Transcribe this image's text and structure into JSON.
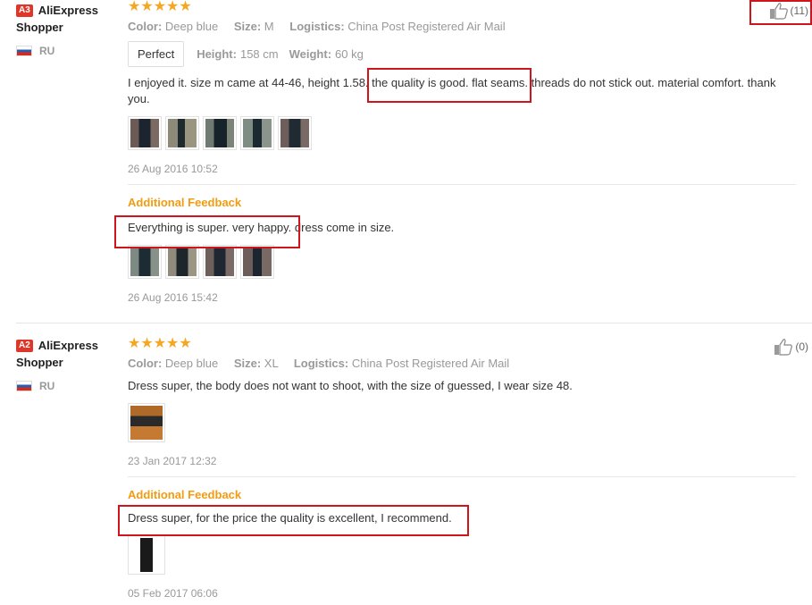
{
  "reviews": [
    {
      "level": "A3",
      "user_name": "AliExpress Shopper",
      "country": "RU",
      "stars": "★★★★★",
      "attrs": [
        {
          "label": "Color:",
          "value": "Deep blue"
        },
        {
          "label": "Size:",
          "value": "M"
        },
        {
          "label": "Logistics:",
          "value": "China Post Registered Air Mail"
        }
      ],
      "fit_tag": "Perfect",
      "height_label": "Height:",
      "height_value": "158 cm",
      "weight_label": "Weight:",
      "weight_value": "60 kg",
      "text": "I enjoyed it. size m came at 44-46, height 1.58. the quality is good. flat seams. threads do not stick out. material comfort. thank you.",
      "date": "26 Aug 2016 10:52",
      "useful_count": "(11)",
      "additional": {
        "title": "Additional Feedback",
        "text": "Everything is super. very happy. dress come in size.",
        "date": "26 Aug 2016 15:42"
      }
    },
    {
      "level": "A2",
      "user_name": "AliExpress Shopper",
      "country": "RU",
      "stars": "★★★★★",
      "attrs": [
        {
          "label": "Color:",
          "value": "Deep blue"
        },
        {
          "label": "Size:",
          "value": "XL"
        },
        {
          "label": "Logistics:",
          "value": "China Post Registered Air Mail"
        }
      ],
      "text": "Dress super, the body does not want to shoot, with the size of guessed, I wear size 48.",
      "date": "23 Jan 2017 12:32",
      "useful_count": "(0)",
      "additional": {
        "title": "Additional Feedback",
        "text": "Dress super, for the price the quality is excellent, I recommend.",
        "date": "05 Feb 2017 06:06"
      }
    }
  ],
  "colors": {
    "highlight": "#d0141b",
    "star": "#f6a623",
    "additional_title": "#f39c12",
    "level_badge": "#e0362a"
  },
  "icons": {
    "like": "thumbs-up-icon",
    "flag": "russia-flag-icon"
  }
}
